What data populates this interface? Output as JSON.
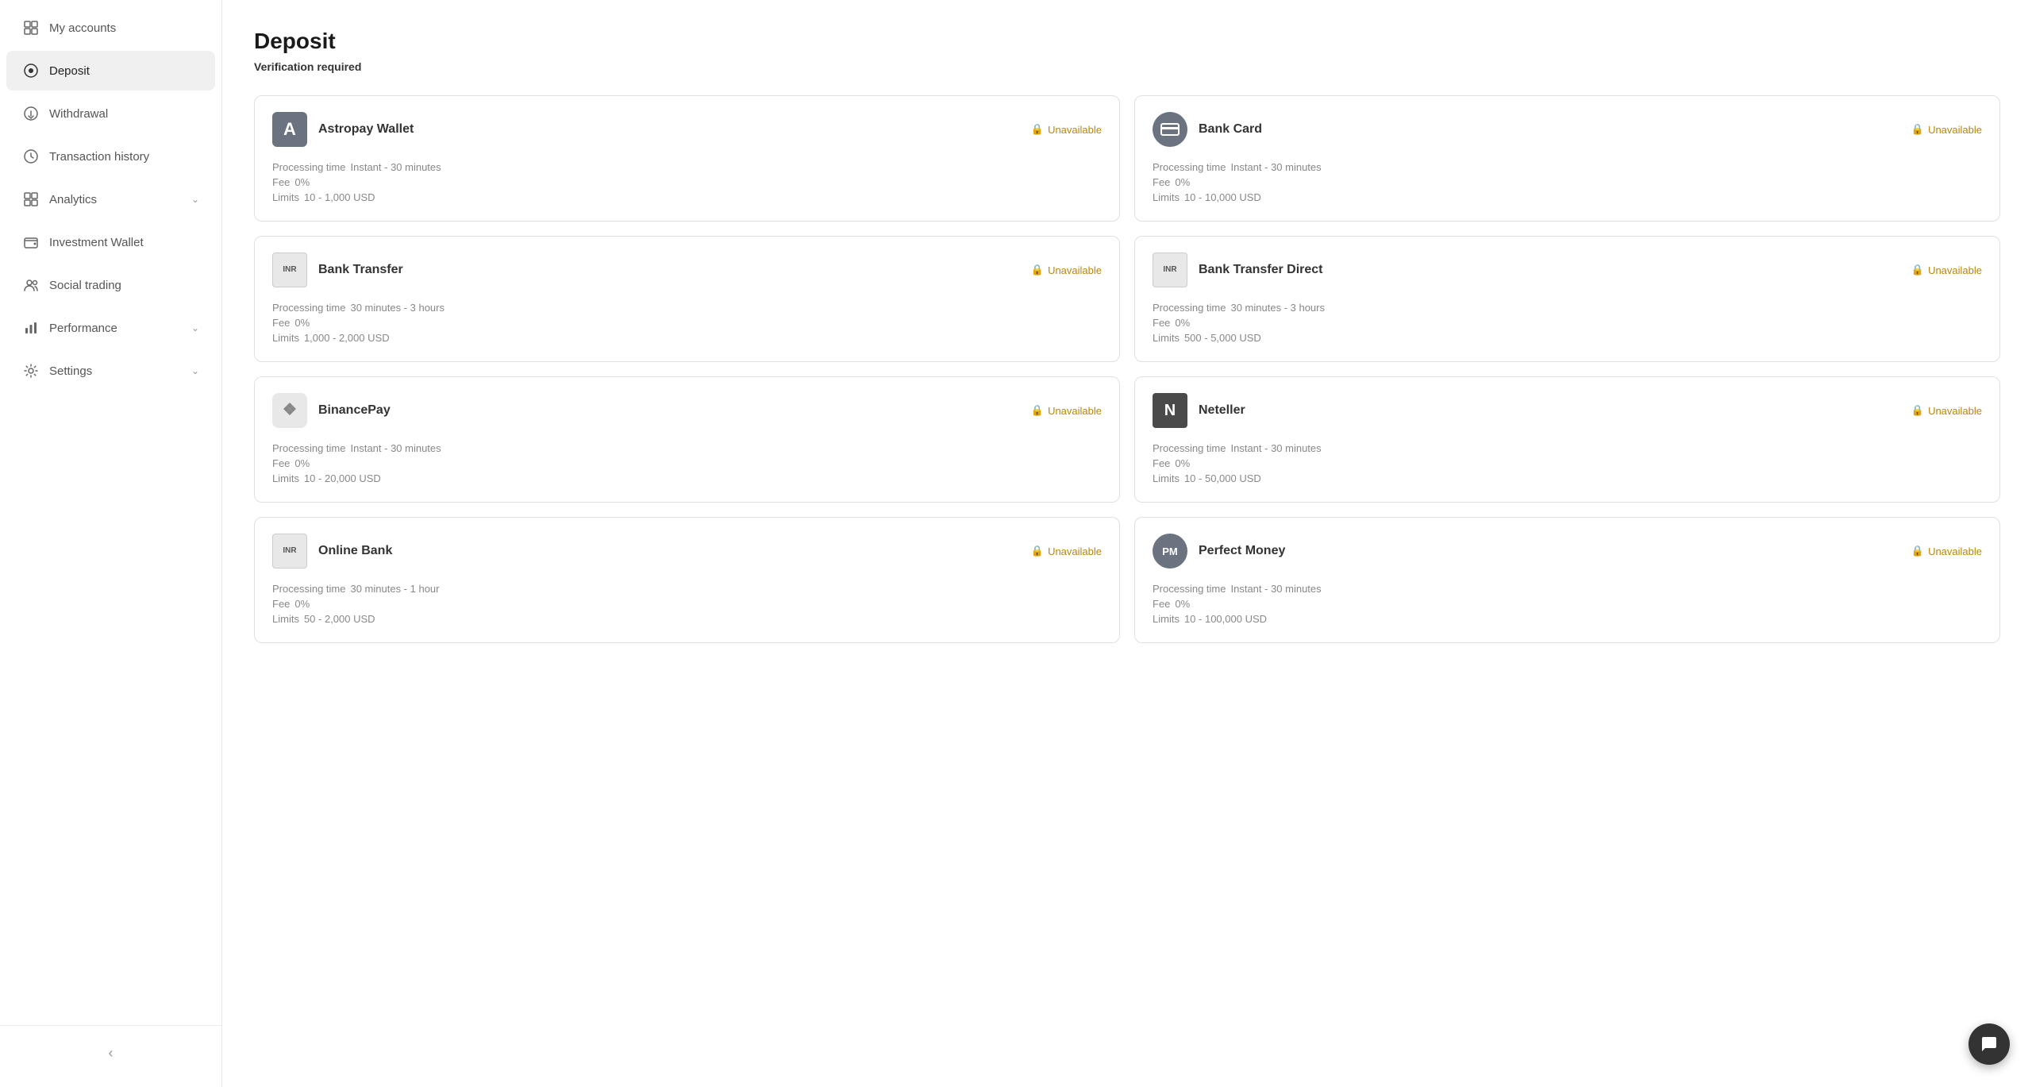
{
  "sidebar": {
    "items": [
      {
        "id": "my-accounts",
        "label": "My accounts",
        "icon": "grid",
        "active": false,
        "hasChevron": false
      },
      {
        "id": "deposit",
        "label": "Deposit",
        "icon": "circle-dot",
        "active": true,
        "hasChevron": false
      },
      {
        "id": "withdrawal",
        "label": "Withdrawal",
        "icon": "circle-arrow",
        "active": false,
        "hasChevron": false
      },
      {
        "id": "transaction-history",
        "label": "Transaction history",
        "icon": "clock",
        "active": false,
        "hasChevron": false
      },
      {
        "id": "analytics",
        "label": "Analytics",
        "icon": "grid-small",
        "active": false,
        "hasChevron": true
      },
      {
        "id": "investment-wallet",
        "label": "Investment Wallet",
        "icon": "wallet",
        "active": false,
        "hasChevron": false
      },
      {
        "id": "social-trading",
        "label": "Social trading",
        "icon": "users",
        "active": false,
        "hasChevron": false
      },
      {
        "id": "performance",
        "label": "Performance",
        "icon": "bar-chart",
        "active": false,
        "hasChevron": true
      },
      {
        "id": "settings",
        "label": "Settings",
        "icon": "gear",
        "active": false,
        "hasChevron": true
      }
    ]
  },
  "page": {
    "title": "Deposit",
    "verification_notice": "Verification required"
  },
  "payment_methods": [
    {
      "id": "astropay",
      "name": "Astropay Wallet",
      "logo_type": "a",
      "logo_text": "A",
      "status": "Unavailable",
      "processing_time": "Instant - 30 minutes",
      "fee": "0%",
      "limits": "10 - 1,000 USD"
    },
    {
      "id": "bank-card",
      "name": "Bank Card",
      "logo_type": "card",
      "logo_text": "💳",
      "status": "Unavailable",
      "processing_time": "Instant - 30 minutes",
      "fee": "0%",
      "limits": "10 - 10,000 USD"
    },
    {
      "id": "bank-transfer",
      "name": "Bank Transfer",
      "logo_type": "inr",
      "logo_text": "INR",
      "status": "Unavailable",
      "processing_time": "30 minutes - 3 hours",
      "fee": "0%",
      "limits": "1,000 - 2,000 USD"
    },
    {
      "id": "bank-transfer-direct",
      "name": "Bank Transfer Direct",
      "logo_type": "inr",
      "logo_text": "INR",
      "status": "Unavailable",
      "processing_time": "30 minutes - 3 hours",
      "fee": "0%",
      "limits": "500 - 5,000 USD"
    },
    {
      "id": "binancepay",
      "name": "BinancePay",
      "logo_type": "binance",
      "logo_text": "◆",
      "status": "Unavailable",
      "processing_time": "Instant - 30 minutes",
      "fee": "0%",
      "limits": "10 - 20,000 USD"
    },
    {
      "id": "neteller",
      "name": "Neteller",
      "logo_type": "n",
      "logo_text": "N",
      "status": "Unavailable",
      "processing_time": "Instant - 30 minutes",
      "fee": "0%",
      "limits": "10 - 50,000 USD"
    },
    {
      "id": "online-bank",
      "name": "Online Bank",
      "logo_type": "inr",
      "logo_text": "INR",
      "status": "Unavailable",
      "processing_time": "30 minutes - 1 hour",
      "fee": "0%",
      "limits": "50 - 2,000 USD"
    },
    {
      "id": "perfect-money",
      "name": "Perfect Money",
      "logo_type": "pm",
      "logo_text": "PM",
      "status": "Unavailable",
      "processing_time": "Instant - 30 minutes",
      "fee": "0%",
      "limits": "10 - 100,000 USD"
    }
  ],
  "labels": {
    "processing_time": "Processing time",
    "fee": "Fee",
    "limits": "Limits",
    "unavailable": "Unavailable",
    "collapse_btn": "‹"
  }
}
